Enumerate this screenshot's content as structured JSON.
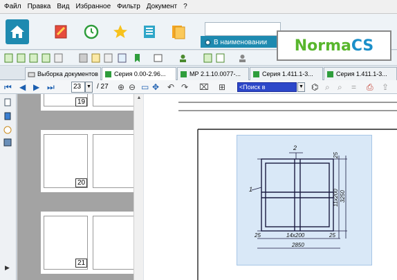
{
  "menu": [
    "Файл",
    "Правка",
    "Вид",
    "Избранное",
    "Фильтр",
    "Документ",
    "?"
  ],
  "search": {
    "radio_label": "В наименовании"
  },
  "logo": {
    "part1": "Norma",
    "part2": "CS"
  },
  "tabs": [
    {
      "label": "Выборка документов"
    },
    {
      "label": "Серия 0.00-2.96..."
    },
    {
      "label": "МР 2.1.10.0077-..."
    },
    {
      "label": "Серия 1.411.1-3..."
    },
    {
      "label": "Серия 1.411.1-3..."
    }
  ],
  "nav": {
    "page": "23",
    "total": "/ 27",
    "search_placeholder": "<Поиск в документе>"
  },
  "thumbnails": [
    {
      "page": "19"
    },
    {
      "page": "20"
    },
    {
      "page": "21"
    }
  ],
  "drawing": {
    "label_top": "2",
    "label_left": "1",
    "dim_right_top": "25",
    "dim_right_mid": "11x200",
    "dim_right_outer": "3250",
    "dim_bottom_left": "25",
    "dim_bottom_inner": "14x200",
    "dim_bottom_right": "25",
    "dim_bottom_total": "2850"
  },
  "colors": {
    "accent": "#1e8ab0",
    "logo_green": "#58b62d",
    "logo_blue": "#1b8fc9",
    "selection": "#d9e8f7"
  }
}
